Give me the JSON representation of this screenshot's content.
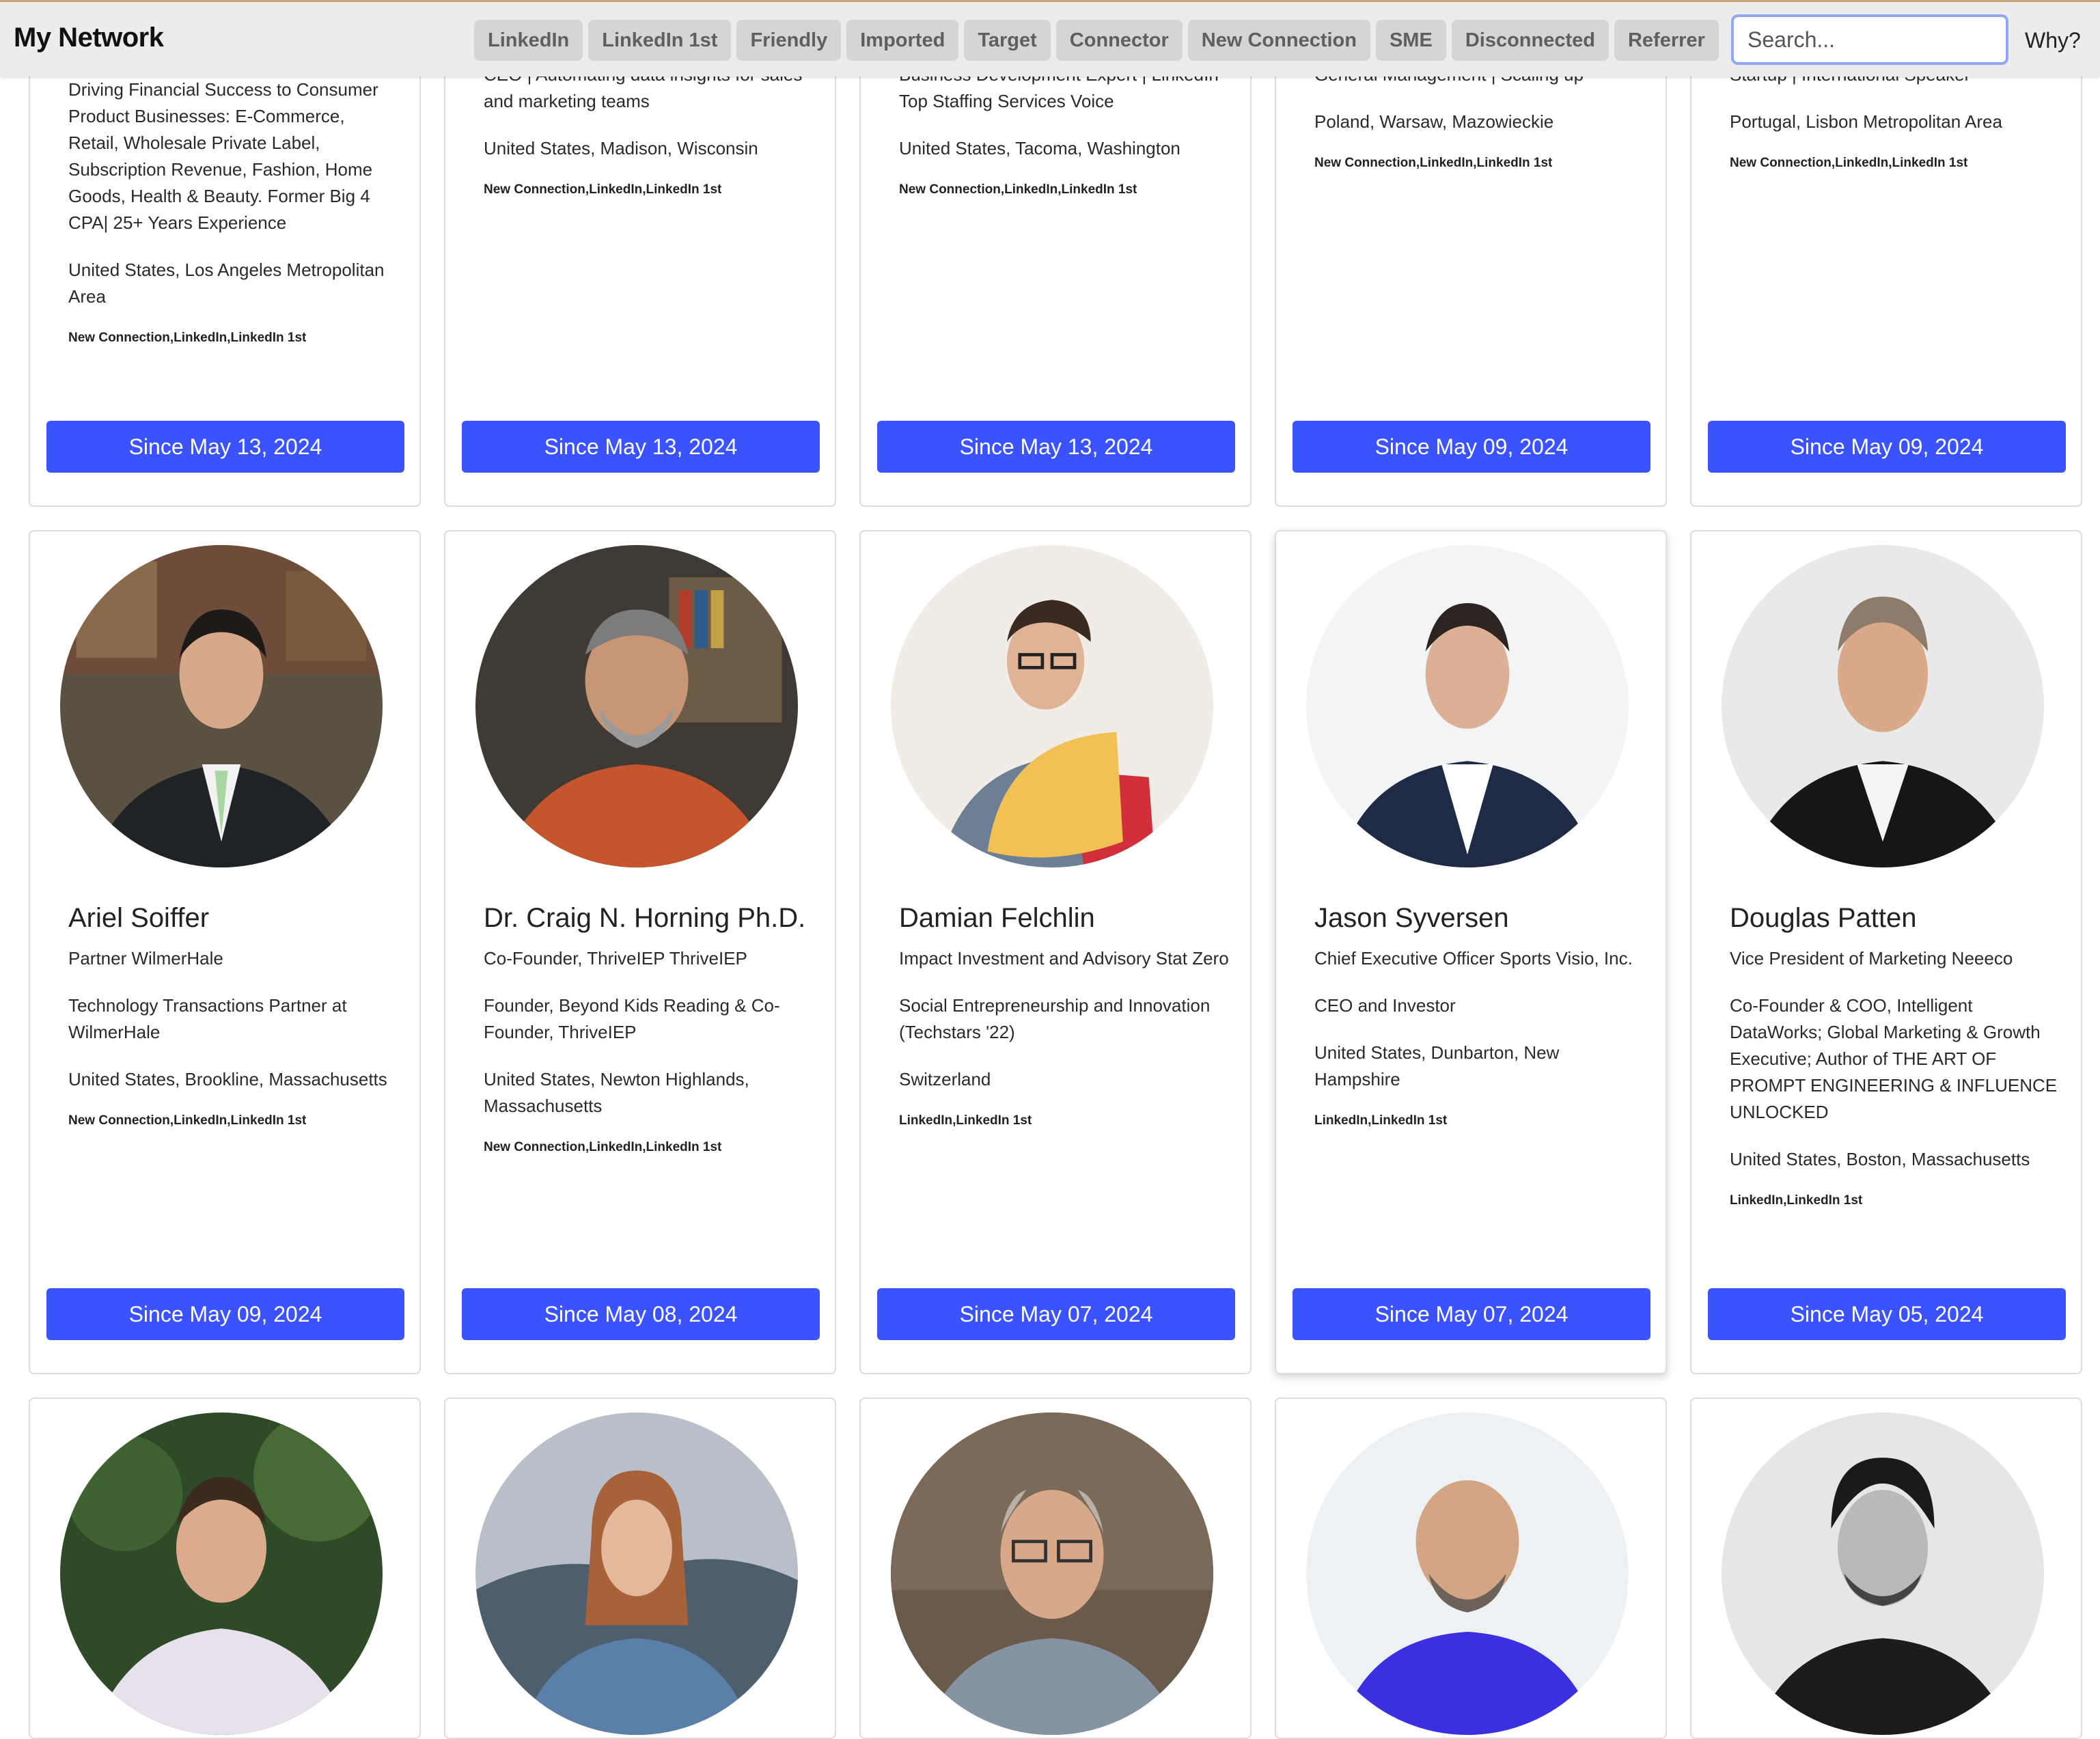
{
  "app": {
    "title": "My Network"
  },
  "filters": [
    "LinkedIn",
    "LinkedIn 1st",
    "Friendly",
    "Imported",
    "Target",
    "Connector",
    "New Connection",
    "SME",
    "Disconnected",
    "Referrer"
  ],
  "search": {
    "placeholder": "Search..."
  },
  "why_link": "Why?",
  "colors": {
    "accent": "#3b53ff",
    "filter_bg": "#d5d5d5",
    "search_border": "#8fa8f5"
  },
  "cards_row1": [
    {
      "lines": [
        "Driving Financial Success to Consumer Product Businesses: E-Commerce, Retail, Wholesale Private Label, Subscription Revenue, Fashion, Home Goods, Health & Beauty. Former Big 4 CPA| 25+ Years Experience",
        "United States, Los Angeles Metropolitan Area"
      ],
      "tags": "New Connection,LinkedIn,LinkedIn 1st",
      "since": "Since May 13, 2024"
    },
    {
      "lines": [
        "CEO | Automating data insights for sales and marketing teams",
        "United States, Madison, Wisconsin"
      ],
      "tags": "New Connection,LinkedIn,LinkedIn 1st",
      "since": "Since May 13, 2024"
    },
    {
      "lines": [
        "Business Development Expert | LinkedIn Top Staffing Services Voice",
        "United States, Tacoma, Washington"
      ],
      "tags": "New Connection,LinkedIn,LinkedIn 1st",
      "since": "Since May 13, 2024"
    },
    {
      "lines": [
        "General Management | Scaling up",
        "Poland, Warsaw, Mazowieckie"
      ],
      "tags": "New Connection,LinkedIn,LinkedIn 1st",
      "since": "Since May 09, 2024"
    },
    {
      "lines": [
        "Startup | International Speaker",
        "Portugal, Lisbon Metropolitan Area"
      ],
      "tags": "New Connection,LinkedIn,LinkedIn 1st",
      "since": "Since May 09, 2024"
    }
  ],
  "cards_row2": [
    {
      "name": "Ariel Soiffer",
      "role": "Partner WilmerHale",
      "headline": "Technology Transactions Partner at WilmerHale",
      "location": "United States, Brookline, Massachusetts",
      "tags": "New Connection,LinkedIn,LinkedIn 1st",
      "since": "Since May 09, 2024"
    },
    {
      "name": "Dr. Craig N. Horning Ph.D.",
      "role": "Co-Founder, ThriveIEP ThriveIEP",
      "headline": "Founder, Beyond Kids Reading & Co-Founder, ThriveIEP",
      "location": "United States, Newton Highlands, Massachusetts",
      "tags": "New Connection,LinkedIn,LinkedIn 1st",
      "since": "Since May 08, 2024"
    },
    {
      "name": "Damian Felchlin",
      "role": "Impact Investment and Advisory Stat Zero",
      "headline": "Social Entrepreneurship and Innovation (Techstars '22)",
      "location": "Switzerland",
      "tags": "LinkedIn,LinkedIn 1st",
      "since": "Since May 07, 2024"
    },
    {
      "name": "Jason Syversen",
      "role": "Chief Executive Officer Sports Visio, Inc.",
      "headline": "CEO and Investor",
      "location": "United States, Dunbarton, New Hampshire",
      "tags": "LinkedIn,LinkedIn 1st",
      "since": "Since May 07, 2024"
    },
    {
      "name": "Douglas Patten",
      "role": "Vice President of Marketing Neeeco",
      "headline": "Co-Founder & COO, Intelligent DataWorks; Global Marketing & Growth Executive; Author of THE ART OF PROMPT ENGINEERING & INFLUENCE UNLOCKED",
      "location": "United States, Boston, Massachusetts",
      "tags": "LinkedIn,LinkedIn 1st",
      "since": "Since May 05, 2024"
    }
  ]
}
